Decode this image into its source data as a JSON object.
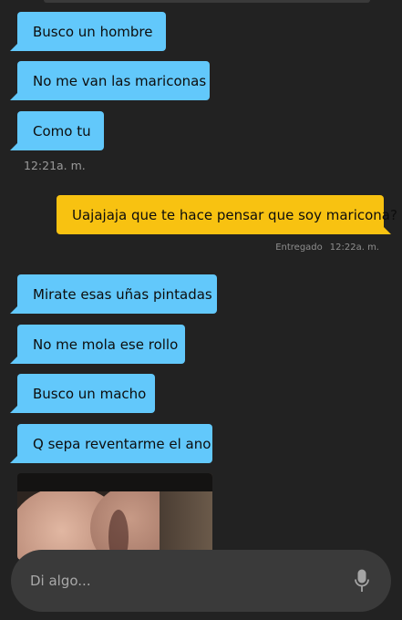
{
  "messages_top": [
    {
      "text": "Busco un hombre"
    },
    {
      "text": "No me van las mariconas"
    },
    {
      "text": "Como tu"
    }
  ],
  "timestamp_1": "12:21a. m.",
  "outgoing": {
    "text": "Uajajaja que te hace pensar que soy maricona?",
    "status": "Entregado",
    "time": "12:22a. m."
  },
  "messages_bottom": [
    {
      "text": "Mirate esas uñas pintadas"
    },
    {
      "text": "No me mola ese rollo"
    },
    {
      "text": "Busco un macho"
    },
    {
      "text": "Q sepa reventarme el ano"
    }
  ],
  "composer": {
    "placeholder": "Di algo...",
    "mic_icon": "microphone-icon"
  },
  "colors": {
    "background": "#222222",
    "incoming_bubble": "#62c8fb",
    "outgoing_bubble": "#f8c211",
    "input_bar": "#3a3a3a"
  }
}
